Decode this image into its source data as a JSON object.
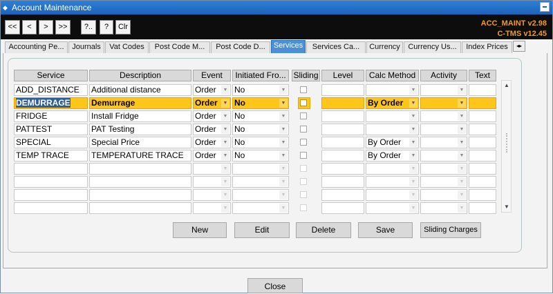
{
  "window": {
    "title": "Account Maintenance"
  },
  "toolbar": {
    "nav_buttons": [
      "<<",
      "<",
      ">",
      ">>",
      "?..",
      "?",
      "Clr"
    ],
    "version_line1": "ACC_MAINT v2.98",
    "version_line2": "C-TMS v12.45",
    "version_color": "#f39c1f"
  },
  "tabs": [
    {
      "label": "Accounting Pe..."
    },
    {
      "label": "Journals"
    },
    {
      "label": "Vat Codes"
    },
    {
      "label": "Post Code M..."
    },
    {
      "label": "Post Code D..."
    },
    {
      "label": "Services",
      "active": true
    },
    {
      "label": "Services Ca..."
    },
    {
      "label": "Currency"
    },
    {
      "label": "Currency Us..."
    },
    {
      "label": "Index Prices"
    }
  ],
  "grid": {
    "columns": [
      "Service",
      "Description",
      "Event",
      "Initiated Fro...",
      "Sliding",
      "Level",
      "Calc Method",
      "Activity",
      "Text"
    ],
    "rows": [
      {
        "service": "ADD_DISTANCE",
        "description": "Additional distance",
        "event": "Order",
        "initiated": "No",
        "calc": ""
      },
      {
        "service": "DEMURRAGE",
        "description": "Demurrage",
        "event": "Order",
        "initiated": "No",
        "calc": "By Order",
        "selected": true
      },
      {
        "service": "FRIDGE",
        "description": "Install Fridge",
        "event": "Order",
        "initiated": "No",
        "calc": ""
      },
      {
        "service": "PATTEST",
        "description": "PAT Testing",
        "event": "Order",
        "initiated": "No",
        "calc": ""
      },
      {
        "service": "SPECIAL",
        "description": "Special Price",
        "event": "Order",
        "initiated": "No",
        "calc": "By Order"
      },
      {
        "service": "TEMP TRACE",
        "description": "TEMPERATURE TRACE",
        "event": "Order",
        "initiated": "No",
        "calc": "By Order"
      }
    ],
    "empty_rows": 4
  },
  "actions": {
    "new": "New",
    "edit": "Edit",
    "delete": "Delete",
    "save": "Save",
    "sliding_charges": "Sliding Charges"
  },
  "footer": {
    "close": "Close"
  },
  "colors": {
    "selected_row": "#ffc61a",
    "titlebar": "#1c63b8",
    "active_tab": "#4b8fd6"
  }
}
